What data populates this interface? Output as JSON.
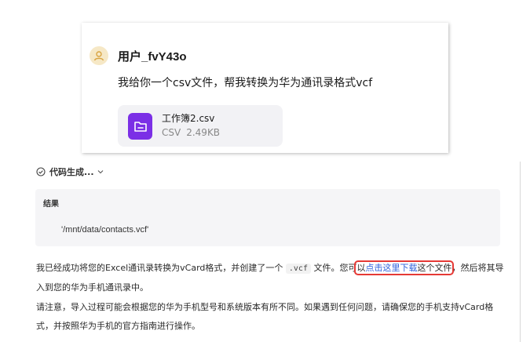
{
  "user": {
    "name": "用户_fvY43o",
    "message": "我给你一个csv文件，帮我转换为华为通讯录格式vcf",
    "file": {
      "name": "工作簿2.csv",
      "type": "CSV",
      "size": "2.49KB"
    }
  },
  "response": {
    "code_toggle_label": "代码生成...",
    "result_title": "结果",
    "result_value": "'/mnt/data/contacts.vcf'",
    "para1": {
      "text_a": "我已经成功将您的Excel通讯录转换为vCard格式，并创建了一个",
      "code": ".vcf",
      "text_b": "文件。您可",
      "text_c": "以",
      "link": "点击这里下载",
      "text_d": "这个文件",
      "text_e": "，然后将其导入到您的华为手机通讯录中。"
    },
    "para2": "请注意，导入过程可能会根据您的华为手机型号和系统版本有所不同。如果遇到任何问题，请确保您的手机支持vCard格式，并按照华为手机的官方指南进行操作。"
  },
  "colors": {
    "file_icon": "#7b2fe6",
    "link": "#2c5fdc",
    "highlight": "#e53935",
    "avatar_bg": "#f6e8c6"
  }
}
